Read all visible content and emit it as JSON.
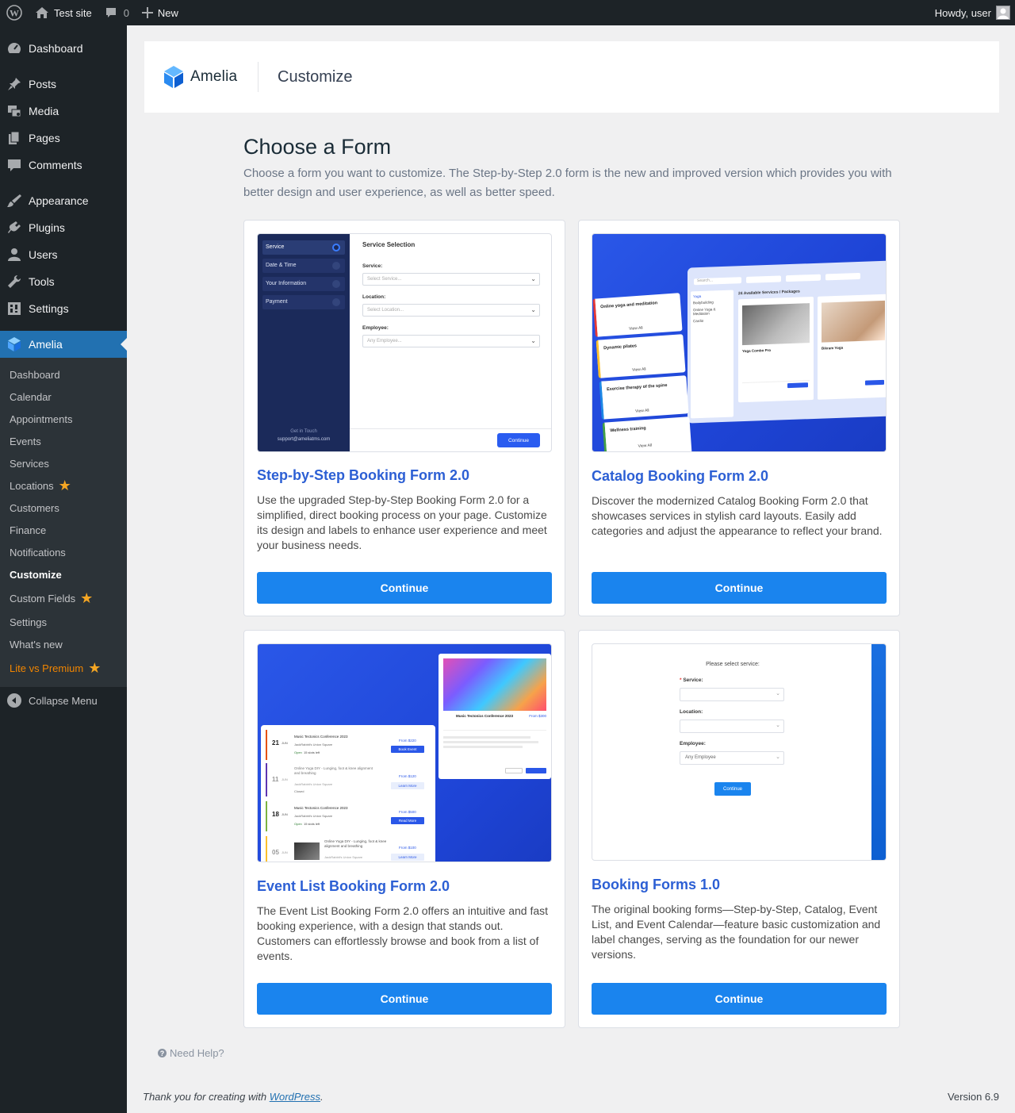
{
  "adminbar": {
    "site_name": "Test site",
    "comments_count": "0",
    "new_label": "New",
    "greeting": "Howdy, user"
  },
  "sidebar": {
    "items": [
      {
        "label": "Dashboard",
        "icon": "dashboard-icon"
      },
      {
        "label": "Posts",
        "icon": "pin-icon"
      },
      {
        "label": "Media",
        "icon": "media-icon"
      },
      {
        "label": "Pages",
        "icon": "pages-icon"
      },
      {
        "label": "Comments",
        "icon": "comment-icon"
      },
      {
        "label": "Appearance",
        "icon": "brush-icon"
      },
      {
        "label": "Plugins",
        "icon": "plugin-icon"
      },
      {
        "label": "Users",
        "icon": "user-icon"
      },
      {
        "label": "Tools",
        "icon": "wrench-icon"
      },
      {
        "label": "Settings",
        "icon": "settings-icon"
      },
      {
        "label": "Amelia",
        "icon": "amelia-icon"
      }
    ],
    "submenu": [
      {
        "label": "Dashboard"
      },
      {
        "label": "Calendar"
      },
      {
        "label": "Appointments"
      },
      {
        "label": "Events"
      },
      {
        "label": "Services"
      },
      {
        "label": "Locations"
      },
      {
        "label": "Customers"
      },
      {
        "label": "Finance"
      },
      {
        "label": "Notifications"
      },
      {
        "label": "Customize"
      },
      {
        "label": "Custom Fields"
      },
      {
        "label": "Settings"
      },
      {
        "label": "What's new"
      },
      {
        "label": "Lite vs Premium"
      }
    ],
    "collapse_label": "Collapse Menu"
  },
  "header": {
    "logo_text": "Amelia",
    "title": "Customize"
  },
  "main": {
    "heading": "Choose a Form",
    "description": "Choose a form you want to customize. The Step-by-Step 2.0 form is the new and improved version which provides you with better design and user experience, as well as better speed.",
    "cards": [
      {
        "title": "Step-by-Step Booking Form 2.0",
        "description": "Use the upgraded Step-by-Step Booking Form 2.0 for a simplified, direct booking process on your page. Customize its design and labels to enhance user experience and meet your business needs.",
        "button": "Continue"
      },
      {
        "title": "Catalog Booking Form 2.0",
        "description": "Discover the modernized Catalog Booking Form 2.0 that showcases services in stylish card layouts. Easily add categories and adjust the appearance to reflect your brand.",
        "button": "Continue"
      },
      {
        "title": "Event List Booking Form 2.0",
        "description": "The Event List Booking Form 2.0 offers an intuitive and fast booking experience, with a design that stands out. Customers can effortlessly browse and book from a list of events.",
        "button": "Continue"
      },
      {
        "title": "Booking Forms 1.0",
        "description": "The original booking forms—Step-by-Step, Catalog, Event List, and Event Calendar—feature basic customization and label changes, serving as the foundation for our newer versions.",
        "button": "Continue"
      }
    ]
  },
  "thumb1": {
    "steps": [
      "Service",
      "Date & Time",
      "Your Information",
      "Payment"
    ],
    "heading": "Service Selection",
    "service_label": "Service:",
    "service_placeholder": "Select Service...",
    "location_label": "Location:",
    "location_placeholder": "Select Location...",
    "employee_label": "Employee:",
    "employee_placeholder": "Any Employee...",
    "contact_title": "Get in Touch",
    "contact_email": "support@ameliatms.com",
    "button": "Continue"
  },
  "thumb2": {
    "cards": [
      "Online yoga and meditation",
      "Dynamic pilates",
      "Exercise therapy of the spine",
      "Wellness training"
    ],
    "view_all": "View All",
    "available": "24 Available Services / Packages",
    "categories": [
      "Yoga",
      "Bodybuilding",
      "Online Yoga & Meditation",
      "Cardio"
    ],
    "services": [
      "Yoga Combo Pro",
      "Bikram Yoga"
    ],
    "search_placeholder": "Search..."
  },
  "thumb3": {
    "events": [
      {
        "day": "21",
        "month": "JUN",
        "name": "Music Tectonics Conference 2023",
        "place": "JackRabbit's Union Square",
        "status": "Open",
        "slots": "15 slots left",
        "price": "From $220",
        "action": "Book Event"
      },
      {
        "day": "11",
        "month": "JUN",
        "name": "Online Yoga DIY - Lunging, foot & knee alignment and breathing",
        "place": "JackRabbit's Union Square",
        "status": "Closed",
        "slots": "",
        "price": "From $120",
        "action": "Learn More"
      },
      {
        "day": "18",
        "month": "JUN",
        "name": "Music Tectonics Conference 2023",
        "place": "JackRabbit's Union Square",
        "status": "Open",
        "slots": "15 slots left",
        "price": "From $500",
        "action": "Read More"
      },
      {
        "day": "05",
        "month": "JUN",
        "name": "Online Yoga DIY - Lunging, foot & knee alignment and breathing",
        "place": "JackRabbit's Union Square",
        "status": "",
        "slots": "",
        "price": "From $100",
        "action": "Learn More"
      }
    ],
    "popup_title": "Music Tectonics Conference 2023",
    "popup_price": "From $300"
  },
  "thumb4": {
    "heading": "Please select service:",
    "service_label": "Service:",
    "location_label": "Location:",
    "employee_label": "Employee:",
    "employee_placeholder": "Any Employee",
    "button": "Continue"
  },
  "footer": {
    "thanks_prefix": "Thank you for creating with ",
    "thanks_link": "WordPress",
    "thanks_suffix": ".",
    "version": "Version 6.9",
    "help": "Need Help?"
  },
  "colors": {
    "primary": "#1a84ee",
    "title_blue": "#2c5fd4",
    "wp_dark": "#1d2327",
    "wp_active": "#2271b1",
    "orange": "#f18500"
  }
}
